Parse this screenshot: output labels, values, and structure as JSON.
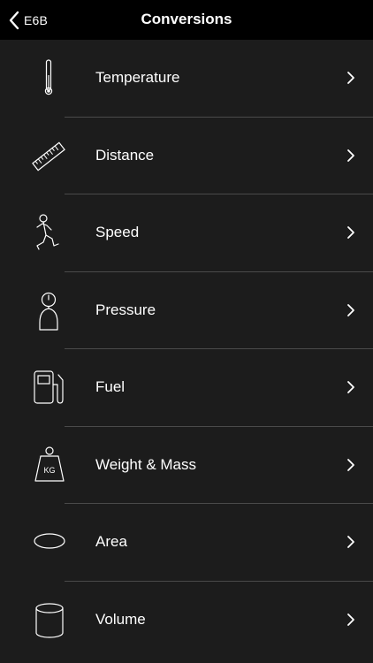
{
  "navbar": {
    "back_label": "E6B",
    "title": "Conversions"
  },
  "list": {
    "items": [
      {
        "label": "Temperature",
        "icon": "thermometer-icon"
      },
      {
        "label": "Distance",
        "icon": "ruler-icon"
      },
      {
        "label": "Speed",
        "icon": "runner-icon"
      },
      {
        "label": "Pressure",
        "icon": "pressure-gauge-icon"
      },
      {
        "label": "Fuel",
        "icon": "fuel-pump-icon"
      },
      {
        "label": "Weight & Mass",
        "icon": "weight-kg-icon"
      },
      {
        "label": "Area",
        "icon": "ellipse-area-icon"
      },
      {
        "label": "Volume",
        "icon": "cylinder-icon"
      }
    ],
    "weight_icon_text": "KG"
  },
  "colors": {
    "background": "#1c1c1c",
    "navbar": "#000000",
    "separator": "#4a4a4a",
    "text": "#ffffff"
  }
}
